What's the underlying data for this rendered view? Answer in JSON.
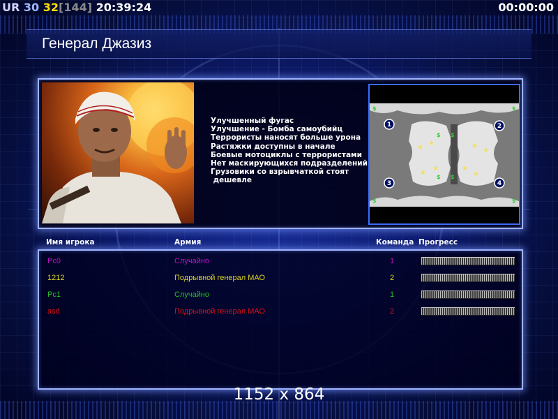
{
  "hud": {
    "ur": "UR",
    "fps": "30",
    "count": "32",
    "bracket": "[144]",
    "clock": "20:39:24",
    "timer": "00:00:00"
  },
  "title": "Генерал Джазиз",
  "description": [
    "Улучшенный фугас",
    "Улучшение - Бомба самоубийц",
    "Террористы наносят больше урона",
    "Растяжки доступны в начале",
    "Боевые мотоциклы с террористами",
    "Нет маскирующихся подразделений",
    "Грузовики со взрывчаткой стоят",
    " дешевле"
  ],
  "minimap": {
    "start_positions": [
      "1",
      "2",
      "3",
      "4"
    ],
    "supply_marker": "$"
  },
  "table": {
    "headers": {
      "player": "Имя игрока",
      "army": "Армия",
      "team": "Команда",
      "progress": "Прогресс"
    },
    "rows": [
      {
        "name": "Pc0",
        "army": "Случайно",
        "team": "1",
        "color": "#c010c8",
        "progress": 1.0
      },
      {
        "name": "1212",
        "army": "Подрывной генерал МАО",
        "team": "2",
        "color": "#d8d020",
        "progress": 1.0
      },
      {
        "name": "Pc1",
        "army": "Случайно",
        "team": "1",
        "color": "#20c020",
        "progress": 1.0
      },
      {
        "name": "asd",
        "army": "Подрывной генерал МАО",
        "team": "2",
        "color": "#e01010",
        "progress": 1.0
      }
    ]
  },
  "resolution": "1152 x 864",
  "colors": {
    "panel_border": "#9fb4ff",
    "minimap_border": "#3a6cff",
    "hud_yellow": "#ffe000"
  }
}
